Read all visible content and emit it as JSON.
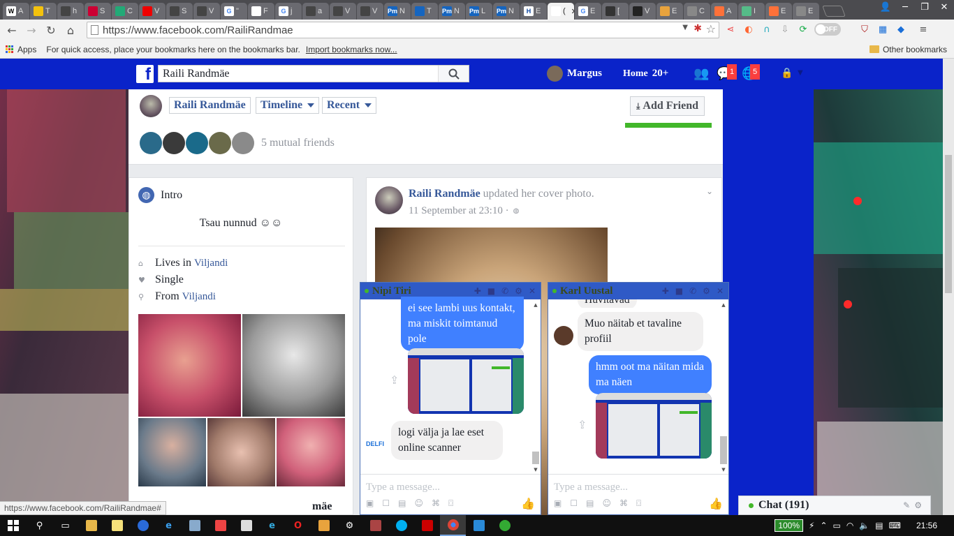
{
  "browser": {
    "tabs": [
      {
        "label": "A",
        "color": "#ffffff",
        "glyph": "W",
        "fg": "#000"
      },
      {
        "label": "T",
        "color": "#f4c20d",
        "glyph": "",
        "fg": "#000"
      },
      {
        "label": "h",
        "color": "#444",
        "glyph": "",
        "fg": "#fff"
      },
      {
        "label": "S",
        "color": "#c03",
        "glyph": "",
        "fg": "#fff"
      },
      {
        "label": "C",
        "color": "#2a7",
        "glyph": "",
        "fg": "#fff"
      },
      {
        "label": "V",
        "color": "#e00",
        "glyph": "",
        "fg": "#fff"
      },
      {
        "label": "S",
        "color": "#444",
        "glyph": "",
        "fg": "#fff"
      },
      {
        "label": "V",
        "color": "#444",
        "glyph": "",
        "fg": "#fff"
      },
      {
        "label": "\"",
        "color": "#fff",
        "glyph": "G",
        "fg": "#4285f4"
      },
      {
        "label": "F",
        "color": "#fff",
        "glyph": "",
        "fg": "#000"
      },
      {
        "label": "j",
        "color": "#fff",
        "glyph": "G",
        "fg": "#4285f4"
      },
      {
        "label": "a",
        "color": "#444",
        "glyph": "",
        "fg": "#fff"
      },
      {
        "label": "V",
        "color": "#444",
        "glyph": "",
        "fg": "#fff"
      },
      {
        "label": "V",
        "color": "#444",
        "glyph": "",
        "fg": "#fff"
      },
      {
        "label": "N",
        "color": "#1565c0",
        "glyph": "Pm",
        "fg": "#fff"
      },
      {
        "label": "T",
        "color": "#1565c0",
        "glyph": "",
        "fg": "#fff"
      },
      {
        "label": "N",
        "color": "#1565c0",
        "glyph": "Pm",
        "fg": "#fff"
      },
      {
        "label": "L",
        "color": "#1565c0",
        "glyph": "Pm",
        "fg": "#fff"
      },
      {
        "label": "N",
        "color": "#1565c0",
        "glyph": "Pm",
        "fg": "#fff"
      },
      {
        "label": "E",
        "color": "#fff",
        "glyph": "H",
        "fg": "#0d47a1"
      },
      {
        "label": "(",
        "color": "#fff",
        "glyph": "",
        "fg": "#000",
        "active": true
      },
      {
        "label": "E",
        "color": "#fff",
        "glyph": "G",
        "fg": "#4285f4"
      },
      {
        "label": "[",
        "color": "#333",
        "glyph": "",
        "fg": "#fff"
      },
      {
        "label": "V",
        "color": "#222",
        "glyph": "",
        "fg": "#fff"
      },
      {
        "label": "E",
        "color": "#e8a33d",
        "glyph": "",
        "fg": "#fff"
      },
      {
        "label": "C",
        "color": "#888",
        "glyph": "",
        "fg": "#fff"
      },
      {
        "label": "A",
        "color": "#ff7139",
        "glyph": "",
        "fg": "#fff"
      },
      {
        "label": "I",
        "color": "#5b8",
        "glyph": "",
        "fg": "#fff"
      },
      {
        "label": "E",
        "color": "#ff7139",
        "glyph": "",
        "fg": "#fff"
      },
      {
        "label": "E",
        "color": "#888",
        "glyph": "",
        "fg": "#fff"
      }
    ],
    "url": "https://www.facebook.com/RailiRandmae",
    "off_label": "OFF",
    "bookmarks": {
      "apps": "Apps",
      "hint": "For quick access, place your bookmarks here on the bookmarks bar.",
      "import": "Import bookmarks now...",
      "other": "Other bookmarks"
    },
    "status_url": "https://www.facebook.com/RailiRandmae#"
  },
  "fb": {
    "logo": "f",
    "search_value": "Raili Randmäe",
    "user_name": "Margus",
    "home": "Home",
    "home_count": "20+",
    "badge_friends": "1",
    "badge_notif": "5",
    "crumbs": [
      "Raili Randmäe",
      "Timeline",
      "Recent"
    ],
    "add_friend": "Add Friend",
    "mutual": "5 mutual friends",
    "intro": {
      "title": "Intro",
      "bio": "Tsau nunnud ☺☺",
      "lives_label": "Lives in",
      "lives_link": "Viljandi",
      "status": "Single",
      "from_label": "From",
      "from_link": "Viljandi",
      "cut_name": "mäe"
    },
    "post": {
      "author": "Raili Randmäe",
      "action": "updated her cover photo.",
      "time": "11 September at 23:10 ·"
    },
    "chat_count": "Chat (191)"
  },
  "chats": [
    {
      "name": "Nipi Tiri",
      "messages": [
        {
          "from": "me",
          "text": "ei see lambi uus kontakt, ma miskit toimtanud pole"
        },
        {
          "from": "them",
          "text": "logi välja ja lae eset online scanner"
        }
      ],
      "sender_logo": "DELFI",
      "placeholder": "Type a message..."
    },
    {
      "name": "Karl Uustal",
      "messages": [
        {
          "from": "them",
          "text": "Huvitavad"
        },
        {
          "from": "them",
          "text": "Muo näitab et tavaline profiil"
        },
        {
          "from": "me",
          "text": "hmm oot ma näitan mida ma näen"
        }
      ],
      "placeholder": "Type a message..."
    }
  ],
  "taskbar": {
    "battery": "100%",
    "time": "21:56"
  }
}
